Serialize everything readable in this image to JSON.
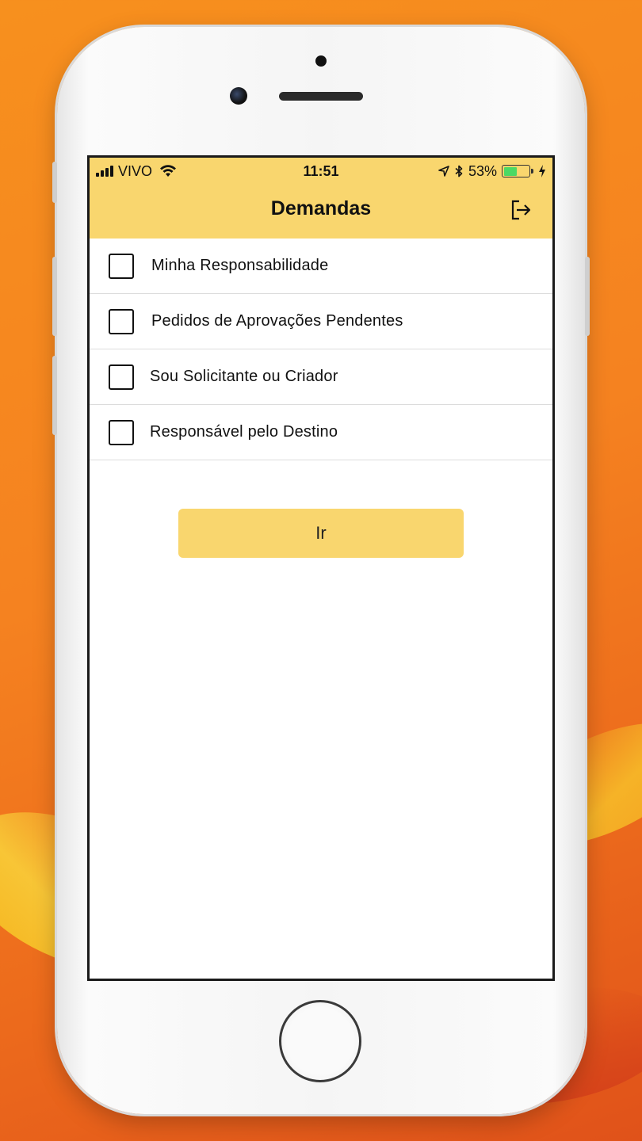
{
  "status_bar": {
    "carrier": "VIVO",
    "time": "11:51",
    "battery_percent_label": "53%",
    "battery_level": 0.53
  },
  "nav": {
    "title": "Demandas",
    "logout_icon": "logout-icon"
  },
  "filters": [
    {
      "label": "Minha Responsabilidade",
      "checked": false
    },
    {
      "label": "Pedidos de Aprovações Pendentes",
      "checked": false
    },
    {
      "label": "Sou Solicitante ou Criador",
      "checked": false
    },
    {
      "label": "Responsável pelo Destino",
      "checked": false
    }
  ],
  "go_button": {
    "label": "Ir"
  },
  "colors": {
    "header_bg": "#f9d66e",
    "button_bg": "#f9d66e",
    "background_orange": "#f58220"
  }
}
